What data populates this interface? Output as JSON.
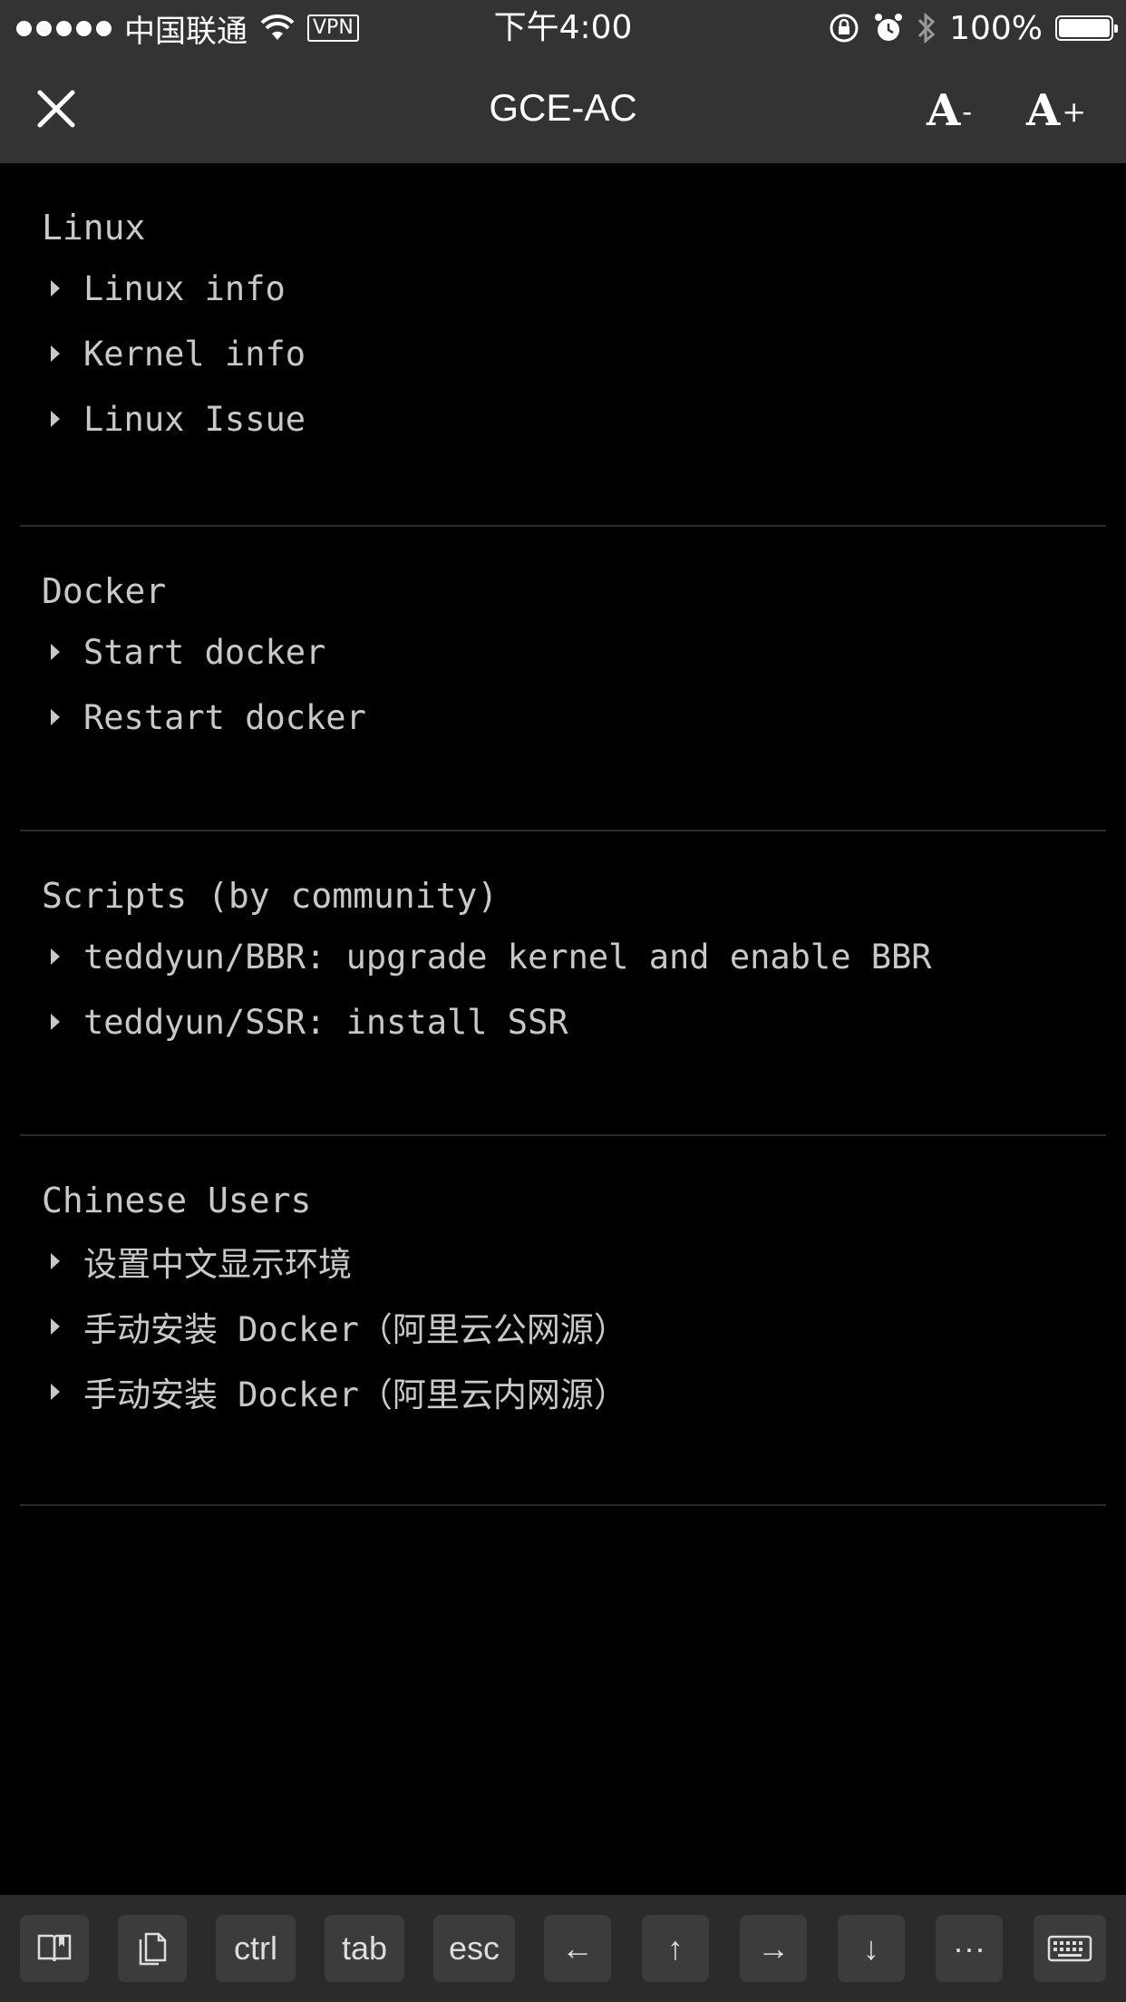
{
  "status_bar": {
    "carrier": "中国联通",
    "vpn": "VPN",
    "time": "下午4:00",
    "battery": "100%"
  },
  "nav": {
    "title": "GCE-AC",
    "font_decrease": "A",
    "font_decrease_sign": "-",
    "font_increase": "A",
    "font_increase_sign": "+"
  },
  "sections": [
    {
      "title": "Linux",
      "items": [
        "Linux info",
        "Kernel info",
        "Linux Issue"
      ]
    },
    {
      "title": "Docker",
      "items": [
        "Start docker",
        "Restart docker"
      ]
    },
    {
      "title": "Scripts (by community)",
      "items": [
        "teddyun/BBR: upgrade kernel and enable BBR",
        "teddyun/SSR: install SSR"
      ]
    },
    {
      "title": "Chinese Users",
      "items": [
        "设置中文显示环境",
        "手动安装 Docker（阿里云公网源）",
        "手动安装 Docker（阿里云内网源）"
      ]
    }
  ],
  "toolbar": {
    "ctrl": "ctrl",
    "tab": "tab",
    "esc": "esc",
    "left": "←",
    "up": "↑",
    "right": "→",
    "down": "↓",
    "more": "···"
  },
  "colors": {
    "bar_bg": "#333333",
    "content_bg": "#000000",
    "text": "#c8c8c8",
    "toolbar_bg": "#2b2b2b",
    "key_bg": "#3c3c3c"
  }
}
